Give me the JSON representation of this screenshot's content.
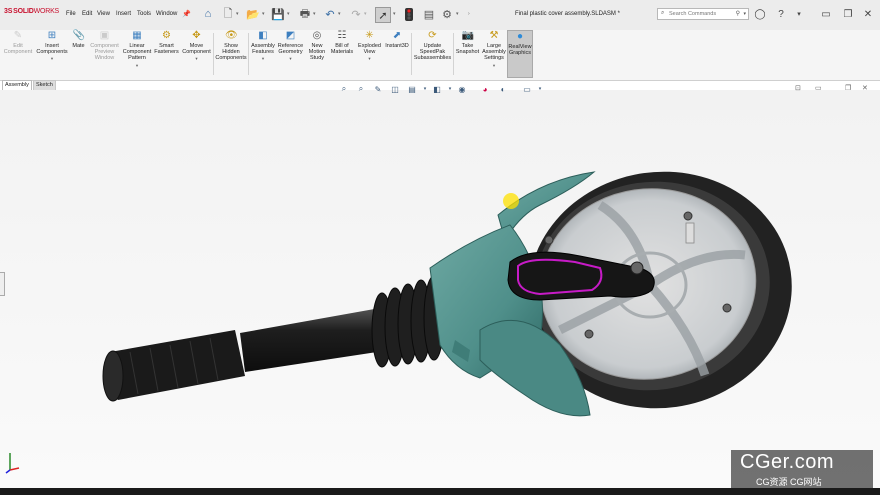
{
  "app": {
    "logo_prefix": "3S",
    "logo_solid": "SOLID",
    "logo_works": "WORKS"
  },
  "menu": [
    "File",
    "Edit",
    "View",
    "Insert",
    "Tools",
    "Window"
  ],
  "document_title": "Final plastic cover assembly.SLDASM *",
  "search": {
    "placeholder": "Search Commands"
  },
  "ribbon": {
    "items": [
      {
        "key": "edit_component",
        "label": "Edit Component",
        "icon": "edit-component-icon",
        "glyph": "✎",
        "enabled": false
      },
      {
        "key": "insert_components",
        "label": "Insert Components",
        "icon": "insert-components-icon",
        "glyph": "⊞",
        "enabled": true
      },
      {
        "key": "mate",
        "label": "Mate",
        "icon": "mate-icon",
        "glyph": "📎",
        "enabled": true
      },
      {
        "key": "component_preview_window",
        "label": "Component Preview Window",
        "icon": "component-preview-icon",
        "glyph": "▣",
        "enabled": false
      },
      {
        "key": "linear_component_pattern",
        "label": "Linear Component Pattern",
        "icon": "linear-pattern-icon",
        "glyph": "▦",
        "enabled": true
      },
      {
        "key": "smart_fasteners",
        "label": "Smart Fasteners",
        "icon": "smart-fasteners-icon",
        "glyph": "⚙",
        "enabled": true
      },
      {
        "key": "move_component",
        "label": "Move Component",
        "icon": "move-component-icon",
        "glyph": "✥",
        "enabled": true
      },
      {
        "key": "show_hidden_components",
        "label": "Show Hidden Components",
        "icon": "show-hidden-icon",
        "glyph": "👁",
        "enabled": true
      },
      {
        "key": "assembly_features",
        "label": "Assembly Features",
        "icon": "assembly-features-icon",
        "glyph": "◧",
        "enabled": true
      },
      {
        "key": "reference_geometry",
        "label": "Reference Geometry",
        "icon": "reference-geometry-icon",
        "glyph": "◩",
        "enabled": true
      },
      {
        "key": "new_motion_study",
        "label": "New Motion Study",
        "icon": "motion-study-icon",
        "glyph": "◎",
        "enabled": true
      },
      {
        "key": "bill_of_materials",
        "label": "Bill of Materials",
        "icon": "bom-icon",
        "glyph": "☷",
        "enabled": true
      },
      {
        "key": "exploded_view",
        "label": "Exploded View",
        "icon": "exploded-view-icon",
        "glyph": "✳",
        "enabled": true
      },
      {
        "key": "instant3d",
        "label": "Instant3D",
        "icon": "instant3d-icon",
        "glyph": "⬈",
        "enabled": true
      },
      {
        "key": "update_speedpak",
        "label": "Update SpeedPak Subassemblies",
        "icon": "speedpak-icon",
        "glyph": "⟳",
        "enabled": true
      },
      {
        "key": "take_snapshot",
        "label": "Take Snapshot",
        "icon": "camera-icon",
        "glyph": "📷",
        "enabled": true
      },
      {
        "key": "large_assembly_settings",
        "label": "Large Assembly Settings",
        "icon": "large-assembly-icon",
        "glyph": "⚒",
        "enabled": true
      },
      {
        "key": "realview_graphics",
        "label": "RealView Graphics",
        "icon": "realview-icon",
        "glyph": "●",
        "enabled": true,
        "active": true
      }
    ]
  },
  "tabs": [
    {
      "label": "Assembly",
      "selected": true
    },
    {
      "label": "Sketch",
      "selected": false
    }
  ],
  "watermark": {
    "title": "CGer.com",
    "subtitle": "CG资源 CG网站"
  },
  "colors": {
    "cover_teal": "#4f8f8a",
    "handle_black": "#1c1c1c",
    "tire_black": "#2a2a2a",
    "accent_magenta": "#c71bc7",
    "ribbon_bg": "#f5f5f5",
    "solidworks_red": "#c8102e"
  }
}
